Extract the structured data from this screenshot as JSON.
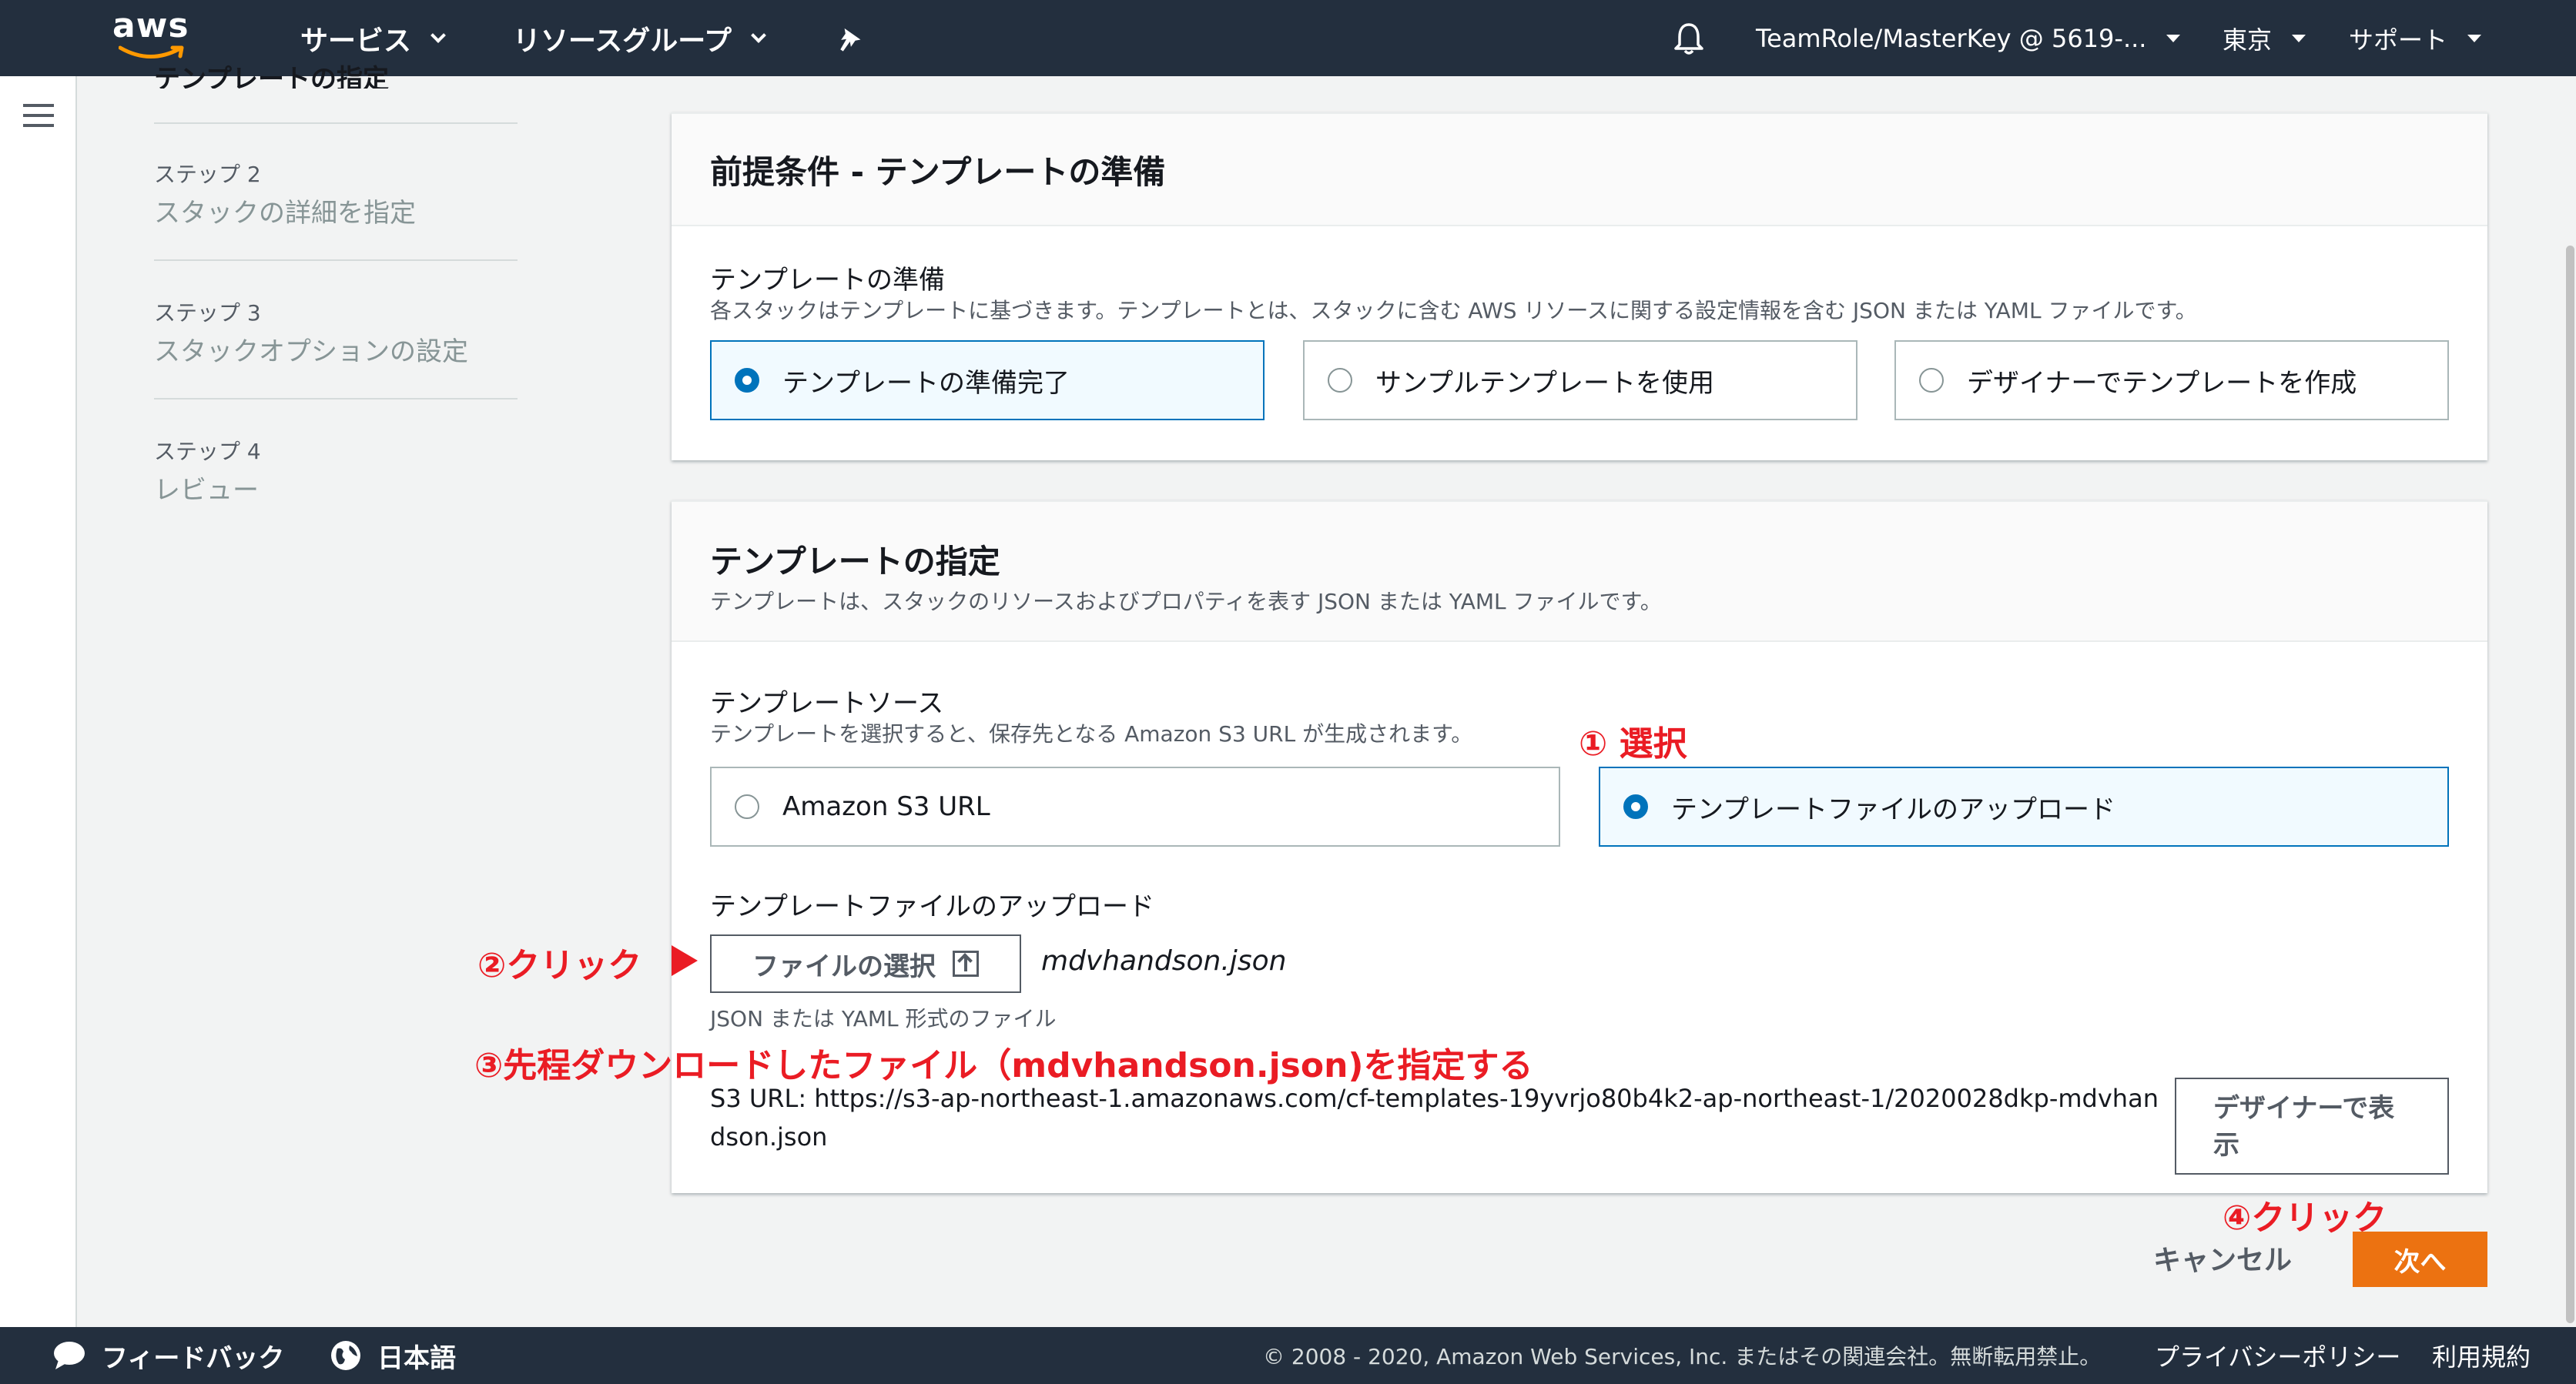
{
  "nav": {
    "logo": "aws",
    "services": "サービス",
    "resource_groups": "リソースグループ",
    "account": "TeamRole/MasterKey @ 5619-...",
    "region": "東京",
    "support": "サポート",
    "icons": [
      "pin-icon",
      "bell-icon",
      "hamburger-icon"
    ]
  },
  "steps": {
    "cutoff_title": "テンプレートの指定",
    "items": [
      {
        "num": "ステップ 2",
        "name": "スタックの詳細を指定"
      },
      {
        "num": "ステップ 3",
        "name": "スタックオプションの設定"
      },
      {
        "num": "ステップ 4",
        "name": "レビュー"
      }
    ]
  },
  "prereq": {
    "title": "前提条件 - テンプレートの準備",
    "label": "テンプレートの準備",
    "desc": "各スタックはテンプレートに基づきます。テンプレートとは、スタックに含む AWS リソースに関する設定情報を含む JSON または YAML ファイルです。",
    "options": [
      {
        "label": "テンプレートの準備完了",
        "selected": true
      },
      {
        "label": "サンプルテンプレートを使用",
        "selected": false
      },
      {
        "label": "デザイナーでテンプレートを作成",
        "selected": false
      }
    ]
  },
  "spec": {
    "title": "テンプレートの指定",
    "desc": "テンプレートは、スタックのリソースおよびプロパティを表す JSON または YAML ファイルです。",
    "source_label": "テンプレートソース",
    "source_desc": "テンプレートを選択すると、保存先となる Amazon S3 URL が生成されます。",
    "sources": [
      {
        "label": "Amazon S3 URL",
        "selected": false
      },
      {
        "label": "テンプレートファイルのアップロード",
        "selected": true
      }
    ],
    "upload_label": "テンプレートファイルのアップロード",
    "choose_file": "ファイルの選択",
    "file_name": "mdvhandson.json",
    "file_hint": "JSON または YAML 形式のファイル",
    "s3_url": "S3 URL:  https://s3-ap-northeast-1.amazonaws.com/cf-templates-19yvrjo80b4k2-ap-northeast-1/2020028dkp-mdvhandson.json",
    "view_designer": "デザイナーで表示"
  },
  "actions": {
    "cancel": "キャンセル",
    "next": "次へ"
  },
  "annotations": {
    "a1": "① 選択",
    "a2": "②クリック",
    "a3": "③先程ダウンロードしたファイル（mdvhandson.json)を指定する",
    "a4": "④クリック",
    "color": "#ea1c24"
  },
  "footer": {
    "feedback": "フィードバック",
    "language": "日本語",
    "copyright": "© 2008 - 2020, Amazon Web Services, Inc. またはその関連会社。無断転用禁止。",
    "privacy": "プライバシーポリシー",
    "terms": "利用規約"
  },
  "colors": {
    "nav_bg": "#232f3e",
    "accent": "#0073bb",
    "primary_button": "#ec7211"
  }
}
